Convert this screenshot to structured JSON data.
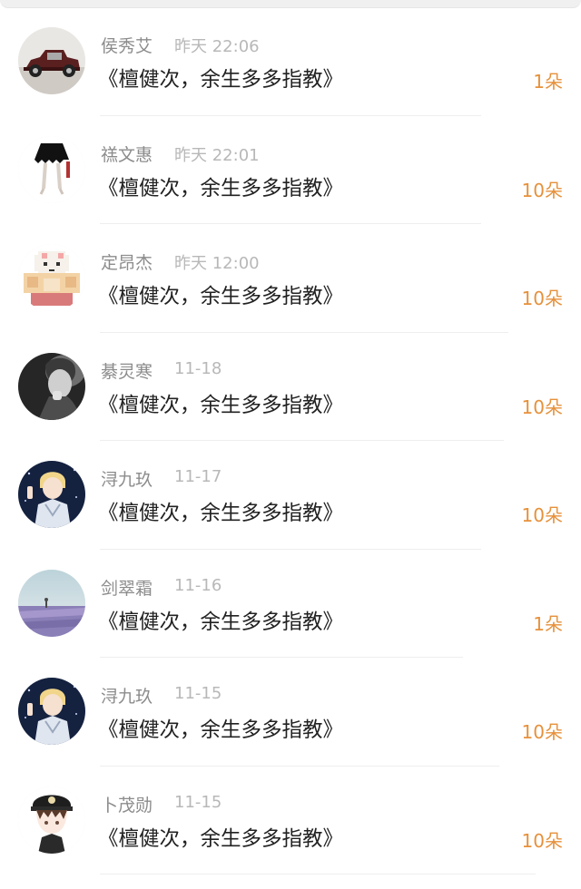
{
  "items": [
    {
      "user": "侯秀艾",
      "time": "昨天 22:06",
      "title": "《檀健次，余生多多指教》",
      "amount": "1朵",
      "avatar": "classic-car-avatar"
    },
    {
      "user": "禚文惠",
      "time": "昨天 22:01",
      "title": "《檀健次，余生多多指教》",
      "amount": "10朵",
      "avatar": "black-skirt-avatar"
    },
    {
      "user": "定昂杰",
      "time": "昨天 12:00",
      "title": "《檀健次，余生多多指教》",
      "amount": "10朵",
      "avatar": "pixel-sheep-avatar"
    },
    {
      "user": "綦灵寒",
      "time": "11-18",
      "title": "《檀健次，余生多多指教》",
      "amount": "10朵",
      "avatar": "grayscale-portrait-avatar"
    },
    {
      "user": "浔九玖",
      "time": "11-17",
      "title": "《檀健次，余生多多指教》",
      "amount": "10朵",
      "avatar": "anime-knight-avatar"
    },
    {
      "user": "剑翠霜",
      "time": "11-16",
      "title": "《檀健次，余生多多指教》",
      "amount": "1朵",
      "avatar": "lavender-field-avatar"
    },
    {
      "user": "浔九玖",
      "time": "11-15",
      "title": "《檀健次，余生多多指教》",
      "amount": "10朵",
      "avatar": "anime-knight-avatar"
    },
    {
      "user": "卜茂勋",
      "time": "11-15",
      "title": "《檀健次，余生多多指教》",
      "amount": "10朵",
      "avatar": "cartoon-sailor-avatar"
    }
  ],
  "colors": {
    "accent": "#e6913b",
    "name": "#8c8c8c",
    "time": "#b8b8b8",
    "title": "#222222",
    "divider": "#eeeeee"
  }
}
